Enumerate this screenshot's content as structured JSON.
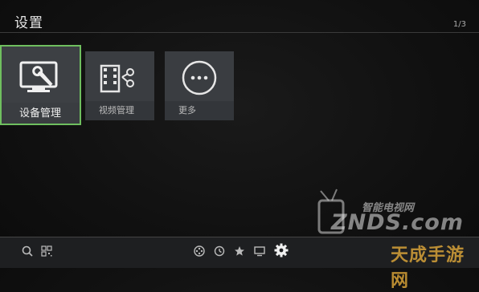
{
  "header": {
    "title": "设置",
    "page_indicator": "1/3"
  },
  "tiles": [
    {
      "label": "设备管理",
      "icon": "monitor-wrench-icon",
      "selected": true
    },
    {
      "label": "视频管理",
      "icon": "film-scissors-icon",
      "selected": false
    },
    {
      "label": "更多",
      "icon": "more-dots-icon",
      "selected": false
    }
  ],
  "bottom_bar": {
    "left_icons": [
      "search-icon",
      "qr-code-icon"
    ],
    "center_icons": [
      "film-reel-icon",
      "history-icon",
      "star-icon",
      "tv-icon",
      "gear-icon"
    ]
  },
  "watermark": {
    "small_text": "智能电视网",
    "main_text": "ZNDS.com",
    "corner_text": "天成手游网"
  },
  "colors": {
    "accent": "#6fbf5f",
    "tile": "#3a3d41",
    "background": "#111111"
  }
}
